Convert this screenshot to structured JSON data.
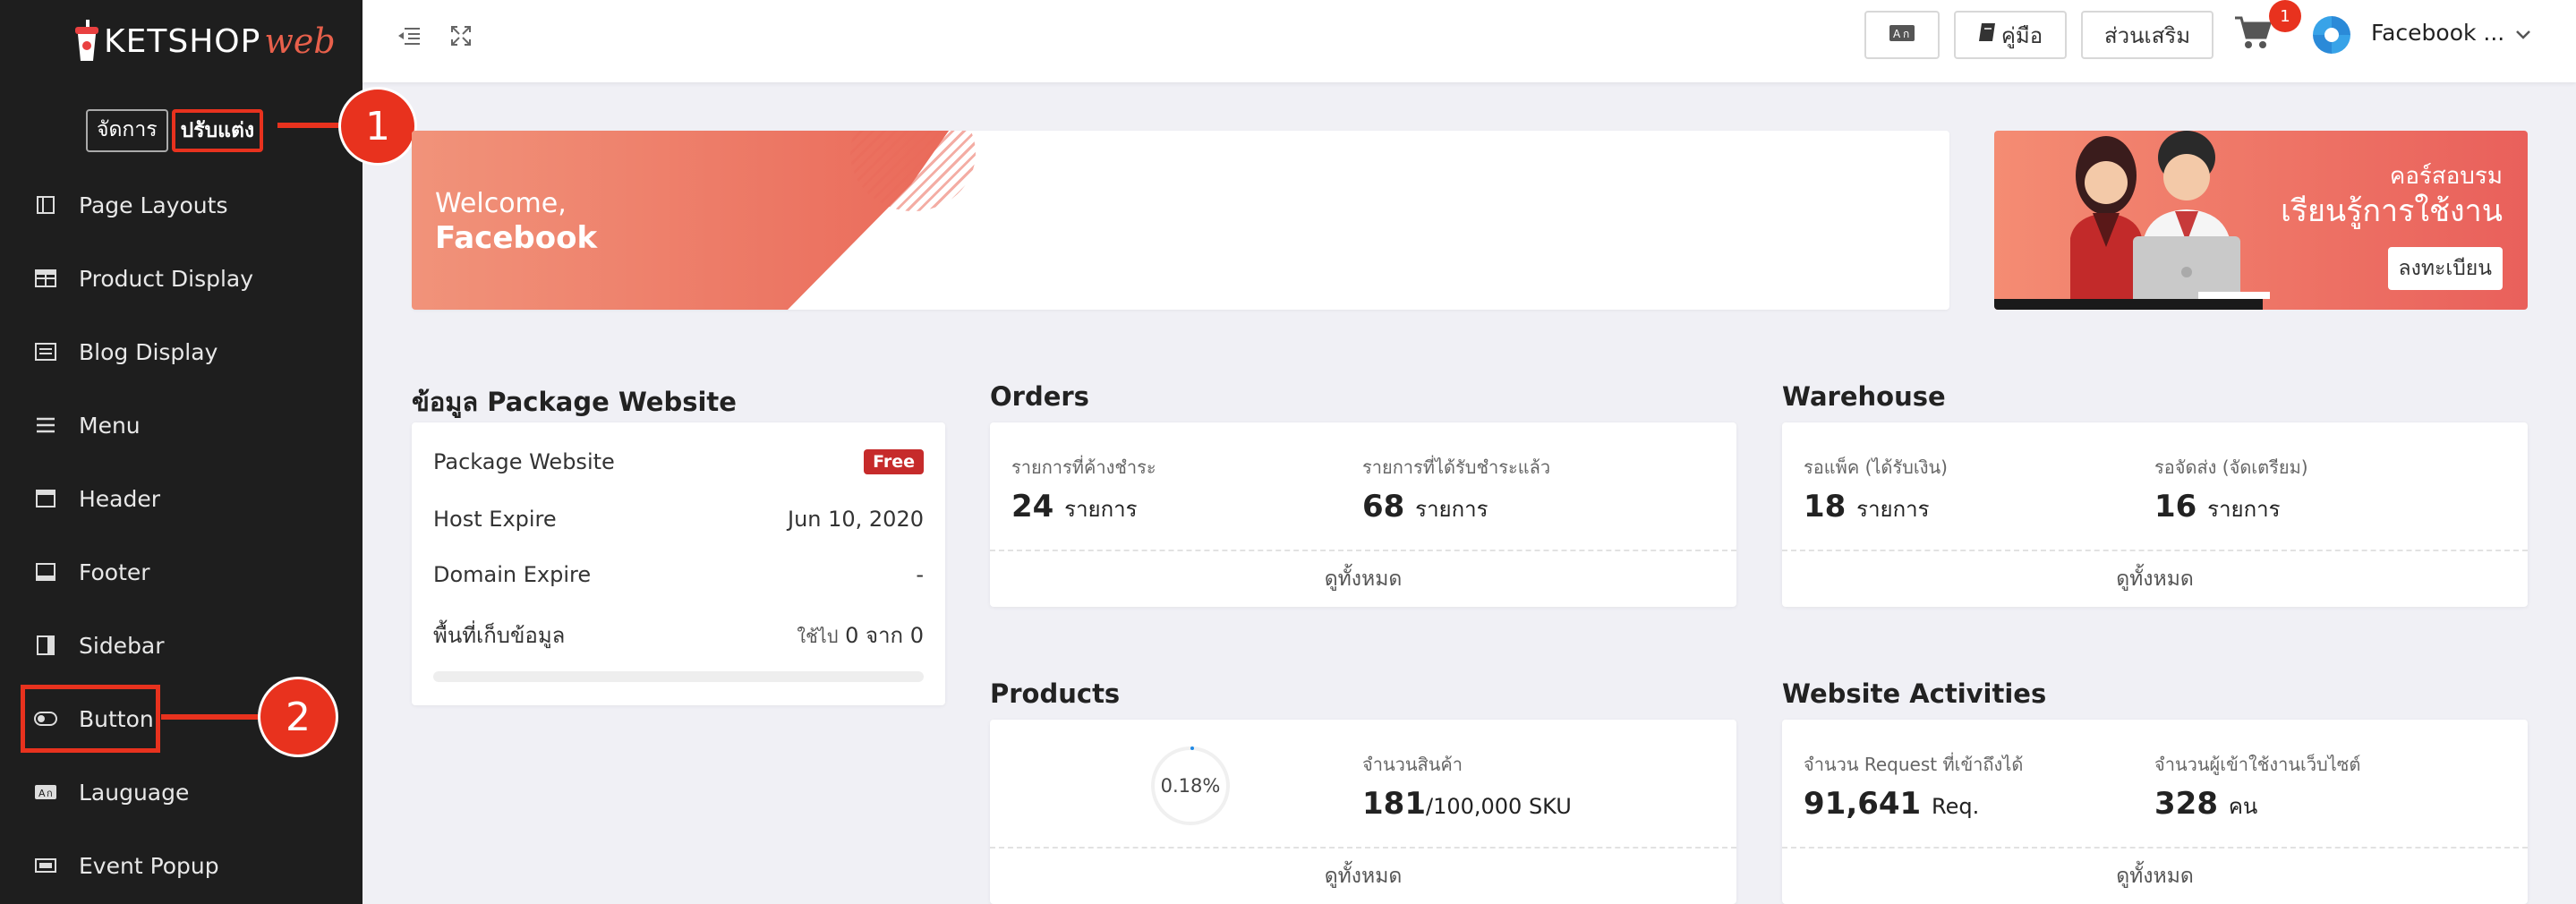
{
  "sidebar": {
    "logo": {
      "ket": "KETSHOP",
      "web": "web"
    },
    "modes": [
      "จัดการ",
      "ปรับแต่ง"
    ],
    "items": [
      {
        "label": "Page Layouts",
        "icon": "layout-icon"
      },
      {
        "label": "Product Display",
        "icon": "grid-icon"
      },
      {
        "label": "Blog Display",
        "icon": "list-box-icon"
      },
      {
        "label": "Menu",
        "icon": "hamburger-icon"
      },
      {
        "label": "Header",
        "icon": "header-icon"
      },
      {
        "label": "Footer",
        "icon": "footer-icon"
      },
      {
        "label": "Sidebar",
        "icon": "sidebar-icon"
      },
      {
        "label": "Button",
        "icon": "toggle-icon"
      },
      {
        "label": "Lauguage",
        "icon": "translate-icon"
      },
      {
        "label": "Event Popup",
        "icon": "popup-icon"
      }
    ]
  },
  "callouts": {
    "one": "1",
    "two": "2"
  },
  "topbar": {
    "guide": "คู่มือ",
    "addons": "ส่วนเสริม",
    "cart_count": "1",
    "account": "Facebook ..."
  },
  "welcome": {
    "line1": "Welcome,",
    "line2": "Facebook"
  },
  "course": {
    "line1": "คอร์สอบรม",
    "line2": "เรียนรู้การใช้งาน",
    "register": "ลงทะเบียน"
  },
  "package": {
    "title": "ข้อมูล Package Website",
    "rows": [
      {
        "label": "Package Website",
        "value": "Free"
      },
      {
        "label": "Host Expire",
        "value": "Jun 10, 2020"
      },
      {
        "label": "Domain Expire",
        "value": "-"
      },
      {
        "label": "พื้นที่เก็บข้อมูล",
        "used_label": "ใช้ไป",
        "used": "0",
        "of": "จาก",
        "total": "0"
      }
    ]
  },
  "orders": {
    "title": "Orders",
    "stats": [
      {
        "label": "รายการที่ค้างชำระ",
        "value": "24",
        "unit": "รายการ"
      },
      {
        "label": "รายการที่ได้รับชำระแล้ว",
        "value": "68",
        "unit": "รายการ"
      }
    ],
    "footer": "ดูทั้งหมด"
  },
  "warehouse": {
    "title": "Warehouse",
    "stats": [
      {
        "label": "รอแพ็ค (ได้รับเงิน)",
        "value": "18",
        "unit": "รายการ"
      },
      {
        "label": "รอจัดส่ง (จัดเตรียม)",
        "value": "16",
        "unit": "รายการ"
      }
    ],
    "footer": "ดูทั้งหมด"
  },
  "products": {
    "title": "Products",
    "percent": "0.18%",
    "label": "จำนวนสินค้า",
    "value": "181",
    "suffix": "/100,000 SKU",
    "footer": "ดูทั้งหมด"
  },
  "activities": {
    "title": "Website Activities",
    "stats": [
      {
        "label": "จำนวน Request ที่เข้าถึงได้",
        "value": "91,641",
        "unit": "Req."
      },
      {
        "label": "จำนวนผู้เข้าใช้งานเว็บไซต์",
        "value": "328",
        "unit": "คน"
      }
    ],
    "footer": "ดูทั้งหมด"
  },
  "colors": {
    "accent": "#e8321e",
    "sidebar": "#1e1e1e",
    "banner": "#ea6a5a"
  }
}
